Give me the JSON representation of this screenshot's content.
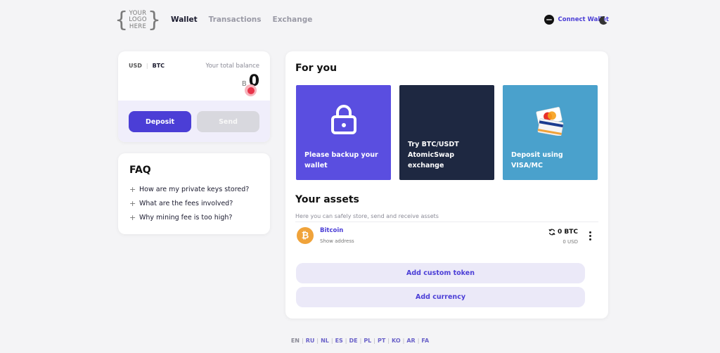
{
  "header": {
    "logo": [
      "YOUR",
      "LOGO",
      "HERE"
    ],
    "nav": [
      {
        "label": "Wallet",
        "active": true
      },
      {
        "label": "Transactions",
        "active": false
      },
      {
        "label": "Exchange",
        "active": false
      }
    ],
    "connect_label": "Connect Wallet",
    "theme_icon": "moon-icon"
  },
  "balance": {
    "currencies": [
      "USD",
      "BTC"
    ],
    "selected_currency": "BTC",
    "label": "Your total balance",
    "symbol": "B",
    "value": "0",
    "deposit_label": "Deposit",
    "send_label": "Send"
  },
  "faq": {
    "title": "FAQ",
    "items": [
      "How are my private keys stored?",
      "What are the fees involved?",
      "Why mining fee is too high?"
    ]
  },
  "for_you": {
    "title": "For you",
    "tiles": [
      {
        "caption": "Please backup your wallet",
        "icon": "lock-icon",
        "color": "#5a4ee0"
      },
      {
        "caption": "Try BTC/USDT AtomicSwap exchange",
        "icon": "",
        "color": "#1e2841"
      },
      {
        "caption": "Deposit using VISA/MC",
        "icon": "credit-cards-icon",
        "color": "#4aa1cc"
      }
    ]
  },
  "assets": {
    "title": "Your assets",
    "subtitle": "Here you can safely store, send and receive assets",
    "items": [
      {
        "name": "Bitcoin",
        "address_label": "Show address",
        "amount": "0 BTC",
        "usd": "0 USD",
        "icon": "bitcoin-icon"
      }
    ],
    "add_token_label": "Add custom token",
    "add_currency_label": "Add currency"
  },
  "languages": [
    "EN",
    "RU",
    "NL",
    "ES",
    "DE",
    "PL",
    "PT",
    "KO",
    "AR",
    "FA"
  ],
  "colors": {
    "accent": "#4b3ed6",
    "background": "#f4f4f6",
    "bitcoin": "#f0a33a"
  }
}
